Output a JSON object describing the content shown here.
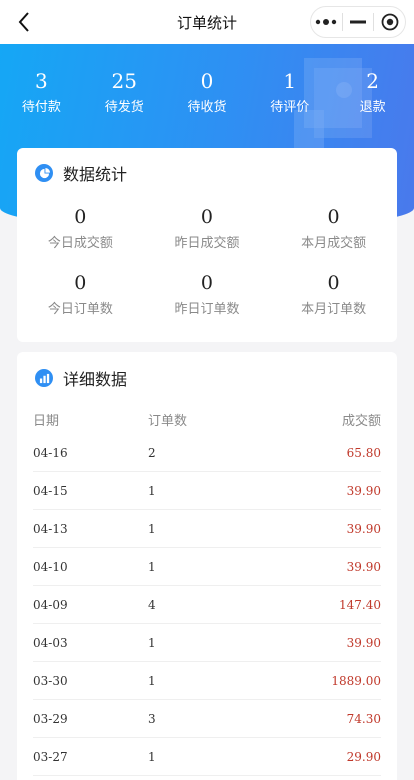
{
  "nav": {
    "title": "订单统计",
    "back_icon": "chevron-left-icon",
    "more_icon": "more-dots-icon",
    "minimize_icon": "minimize-icon",
    "close_icon": "target-circle-icon"
  },
  "status": [
    {
      "count": "3",
      "label": "待付款"
    },
    {
      "count": "25",
      "label": "待发货"
    },
    {
      "count": "0",
      "label": "待收货"
    },
    {
      "count": "1",
      "label": "待评价"
    },
    {
      "count": "2",
      "label": "退款"
    }
  ],
  "stats": {
    "title": "数据统计",
    "icon": "pie-chart-icon",
    "items": [
      {
        "value": "0",
        "label": "今日成交额"
      },
      {
        "value": "0",
        "label": "昨日成交额"
      },
      {
        "value": "0",
        "label": "本月成交额"
      },
      {
        "value": "0",
        "label": "今日订单数"
      },
      {
        "value": "0",
        "label": "昨日订单数"
      },
      {
        "value": "0",
        "label": "本月订单数"
      }
    ]
  },
  "detail": {
    "title": "详细数据",
    "icon": "bar-chart-icon",
    "headers": {
      "date": "日期",
      "orders": "订单数",
      "amount": "成交额"
    },
    "rows": [
      {
        "date": "04-16",
        "orders": "2",
        "amount": "65.80"
      },
      {
        "date": "04-15",
        "orders": "1",
        "amount": "39.90"
      },
      {
        "date": "04-13",
        "orders": "1",
        "amount": "39.90"
      },
      {
        "date": "04-10",
        "orders": "1",
        "amount": "39.90"
      },
      {
        "date": "04-09",
        "orders": "4",
        "amount": "147.40"
      },
      {
        "date": "04-03",
        "orders": "1",
        "amount": "39.90"
      },
      {
        "date": "03-30",
        "orders": "1",
        "amount": "1889.00"
      },
      {
        "date": "03-29",
        "orders": "3",
        "amount": "74.30"
      },
      {
        "date": "03-27",
        "orders": "1",
        "amount": "29.90"
      }
    ]
  },
  "colors": {
    "gradient_start": "#15a7f5",
    "gradient_end": "#4a79ec",
    "accent_blue": "#2f8ff3",
    "amount_red": "#c0392b"
  }
}
